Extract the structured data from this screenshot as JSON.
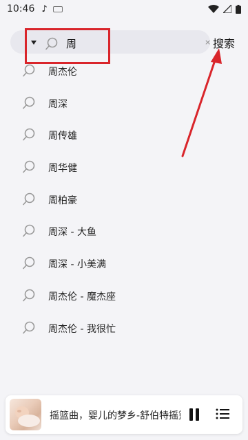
{
  "status": {
    "time": "10:46",
    "note_icon": "music-note-icon",
    "colors": {
      "battery": "#222222"
    }
  },
  "search": {
    "value": "周",
    "clear_glyph": "×",
    "submit_label": "搜索"
  },
  "suggestions": [
    {
      "label": "周杰伦"
    },
    {
      "label": "周深"
    },
    {
      "label": "周传雄"
    },
    {
      "label": "周华健"
    },
    {
      "label": "周柏豪"
    },
    {
      "label": "周深 - 大鱼"
    },
    {
      "label": "周深 - 小美满"
    },
    {
      "label": "周杰伦 - 魔杰座"
    },
    {
      "label": "周杰伦 - 我很忙"
    }
  ],
  "player": {
    "title": "摇篮曲，婴儿的梦乡-舒伯特摇篮曲"
  },
  "colors": {
    "annotation": "#d9252b",
    "background": "#f4f4f7",
    "search_box": "#e8e8ee"
  }
}
